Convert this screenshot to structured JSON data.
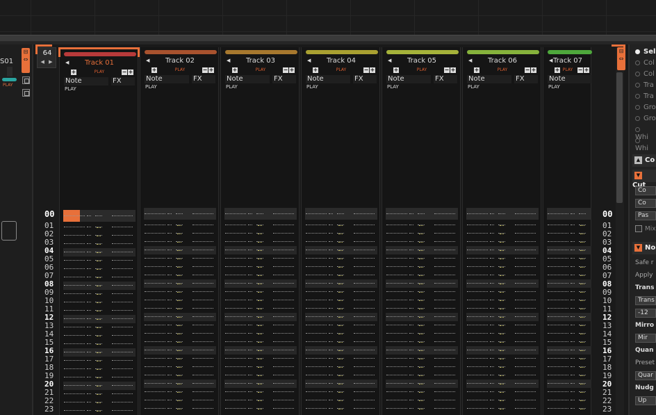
{
  "left_panel": {
    "label": "S01",
    "play_label": "PLAY"
  },
  "pattern": {
    "length": "64"
  },
  "row_numbers": [
    "00",
    "01",
    "02",
    "03",
    "04",
    "05",
    "06",
    "07",
    "08",
    "09",
    "10",
    "11",
    "12",
    "13",
    "14",
    "15",
    "16",
    "17",
    "18",
    "19",
    "20",
    "21",
    "22",
    "23"
  ],
  "tracks": [
    {
      "name": "Track 01",
      "color": "#b83a3a",
      "selected": true
    },
    {
      "name": "Track 02",
      "color": "#a8522e"
    },
    {
      "name": "Track 03",
      "color": "#a7782e"
    },
    {
      "name": "Track 04",
      "color": "#a9a031"
    },
    {
      "name": "Track 05",
      "color": "#a5b23a"
    },
    {
      "name": "Track 06",
      "color": "#86b23c"
    },
    {
      "name": "Track 07",
      "color": "#4ea83c"
    }
  ],
  "track_labels": {
    "play": "PLAY",
    "note": "Note",
    "fx": "FX",
    "play_sub": "PLAY",
    "plus": "+",
    "minus": "−"
  },
  "inspector": {
    "radios": [
      {
        "label": "Sel",
        "selected": true
      },
      {
        "label": "Col"
      },
      {
        "label": "Col"
      },
      {
        "label": "Tra"
      },
      {
        "label": "Tra"
      },
      {
        "label": "Gro"
      },
      {
        "label": "Gro"
      },
      {
        "label": "Whi"
      },
      {
        "label": "Whi"
      }
    ],
    "section_copy": "Co",
    "section_cut": "Cut",
    "buttons_cut": [
      "Co",
      "Co",
      "Pas"
    ],
    "mix_label": "Mix",
    "section_note": "No",
    "safe_label": "Safe r",
    "apply_label": "Apply",
    "transpose_label": "Trans",
    "transpose_button": "Trans",
    "transpose_value": "-12",
    "mirror_label": "Mirro",
    "mirror_button": "Mir",
    "quantize_label": "Quan",
    "preset_label": "Preset",
    "quantize_button": "Quar",
    "nudge_label": "Nudg",
    "nudge_button": "Up"
  }
}
